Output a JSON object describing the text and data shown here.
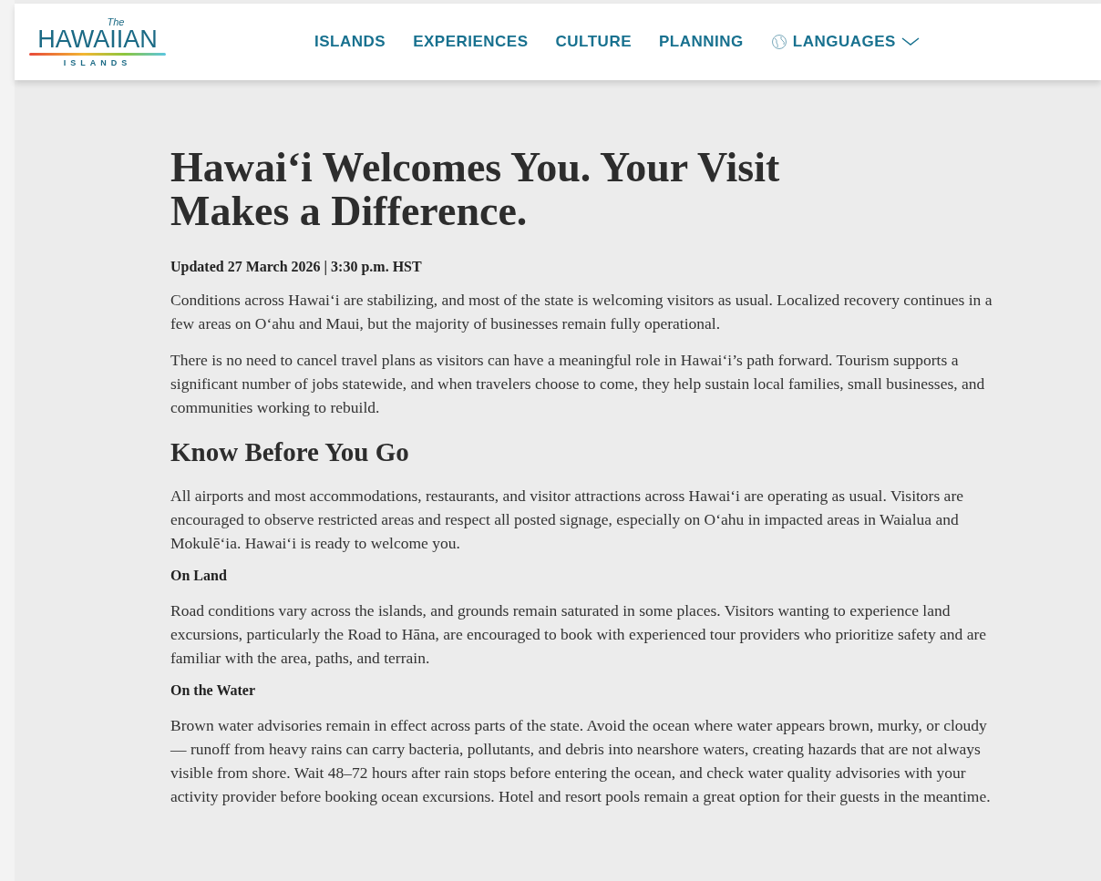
{
  "logo": {
    "script": "The",
    "name": "HAWAIIAN",
    "tagline": "ISLANDS"
  },
  "nav": [
    {
      "label": "ISLANDS",
      "kind": "link"
    },
    {
      "label": "EXPERIENCES",
      "kind": "link"
    },
    {
      "label": "CULTURE",
      "kind": "link"
    },
    {
      "label": "PLANNING",
      "kind": "link"
    },
    {
      "label": "LANGUAGES",
      "kind": "dropdown"
    }
  ],
  "title": "Hawaiʻi Welcomes You. Your Visit Makes a Difference.",
  "blocks": [
    {
      "kind": "meta",
      "text": "Updated 27 March 2026 | 3:30 p.m. HST"
    },
    {
      "kind": "paragraph",
      "text": "Conditions across Hawaiʻi are stabilizing, and most of the state is welcoming visitors as usual. Localized recovery continues in a few areas on Oʻahu and Maui, but the majority of businesses remain fully operational."
    },
    {
      "kind": "paragraph",
      "text": "There is no need to cancel travel plans as visitors can have a meaningful role in Hawaiʻi’s path forward. Tourism supports a significant number of jobs statewide, and when travelers choose to come, they help sustain local families, small businesses, and communities working to rebuild."
    },
    {
      "kind": "heading",
      "text": "Know Before You Go"
    },
    {
      "kind": "paragraph",
      "text": "All airports and most accommodations, restaurants, and visitor attractions across Hawaiʻi are operating as usual. Visitors are encouraged to observe restricted areas and respect all posted signage, especially on Oʻahu in impacted areas in Waialua and Mokulēʻia. Hawaiʻi is ready to welcome you."
    },
    {
      "kind": "subheading",
      "text": "On Land"
    },
    {
      "kind": "paragraph",
      "text": "Road conditions vary across the islands, and grounds remain saturated in some places. Visitors wanting to experience land excursions, particularly the Road to Hāna, are encouraged to book with experienced tour providers who prioritize safety and are familiar with the area, paths, and terrain."
    },
    {
      "kind": "subheading",
      "text": "On the Water"
    },
    {
      "kind": "paragraph",
      "text": "Brown water advisories remain in effect across parts of the state. Avoid the ocean where water appears brown, murky, or cloudy — runoff from heavy rains can carry bacteria, pollutants, and debris into nearshore waters, creating hazards that are not always visible from shore. Wait 48–72 hours after rain stops before entering the ocean, and check water quality advisories with your activity provider before booking ocean excursions. Hotel and resort pools remain a great option for their guests in the meantime."
    }
  ]
}
